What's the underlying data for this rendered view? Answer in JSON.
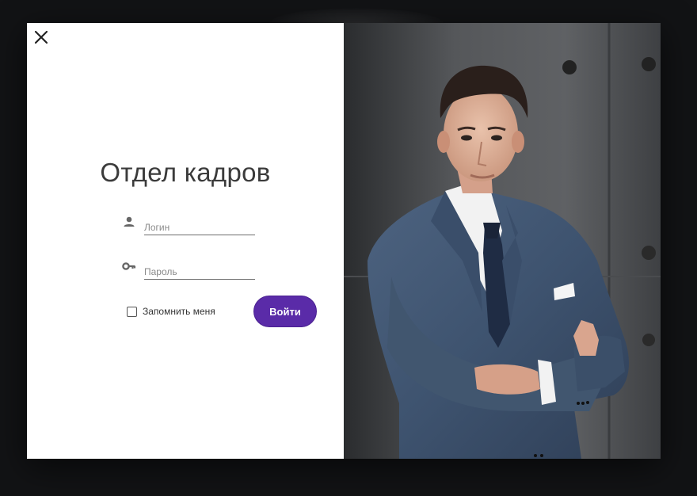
{
  "dialog": {
    "title": "Отдел кадров"
  },
  "login_field": {
    "placeholder": "Логин",
    "value": ""
  },
  "password_field": {
    "placeholder": "Пароль",
    "value": ""
  },
  "remember": {
    "label": "Запомнить меня",
    "checked": false
  },
  "submit": {
    "label": "Войти"
  },
  "icons": {
    "close": "close-icon",
    "user": "user-icon",
    "key": "key-icon"
  },
  "colors": {
    "accent": "#5a2ba8",
    "backdrop": "#121315"
  }
}
